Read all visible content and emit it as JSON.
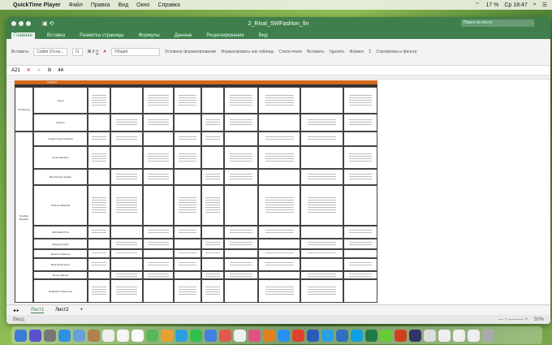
{
  "menubar": {
    "app": "QuickTime Player",
    "items": [
      "Файл",
      "Правка",
      "Вид",
      "Окно",
      "Справка"
    ],
    "battery": "17 %",
    "clock": "Ср 18:47"
  },
  "window": {
    "title": "2_Rival_SWFashion_fin",
    "search_placeholder": "Поиск на листе"
  },
  "ribbon": {
    "tabs": [
      "Главная",
      "Вставка",
      "Разметка страницы",
      "Формулы",
      "Данные",
      "Рецензирование",
      "Вид"
    ],
    "paste": "Вставить",
    "font": "Calibri (Осно...",
    "size": "11",
    "number_format": "Общий",
    "cond_format": "Условное форматирование",
    "format_table": "Форматировать как таблицу",
    "cell_styles": "Стили ячеек",
    "insert": "Вставить",
    "delete": "Удалить",
    "format": "Формат",
    "sort": "Сортировка и фильтр"
  },
  "formula": {
    "cell": "A21",
    "value": "44"
  },
  "sheet": {
    "header_category": "Category",
    "groups": [
      "Positioning",
      "Tangible Benefits"
    ],
    "rows": [
      "About",
      "Mission",
      "Unique Customizations",
      "Personalization",
      "Best Product Quality",
      "Product Materials",
      "Affordable Price",
      "Shipping Policy",
      "Speed of Delivery",
      "Best Dimensions",
      "Money Refund",
      "Reputation Statement"
    ]
  },
  "sheet_tabs": [
    "Лист1",
    "Лист2",
    "+"
  ],
  "status": {
    "mode": "Ввод",
    "zoom": "50%"
  },
  "colors": {
    "excel_green": "#3f7f4c",
    "header_orange": "#d2691e"
  }
}
